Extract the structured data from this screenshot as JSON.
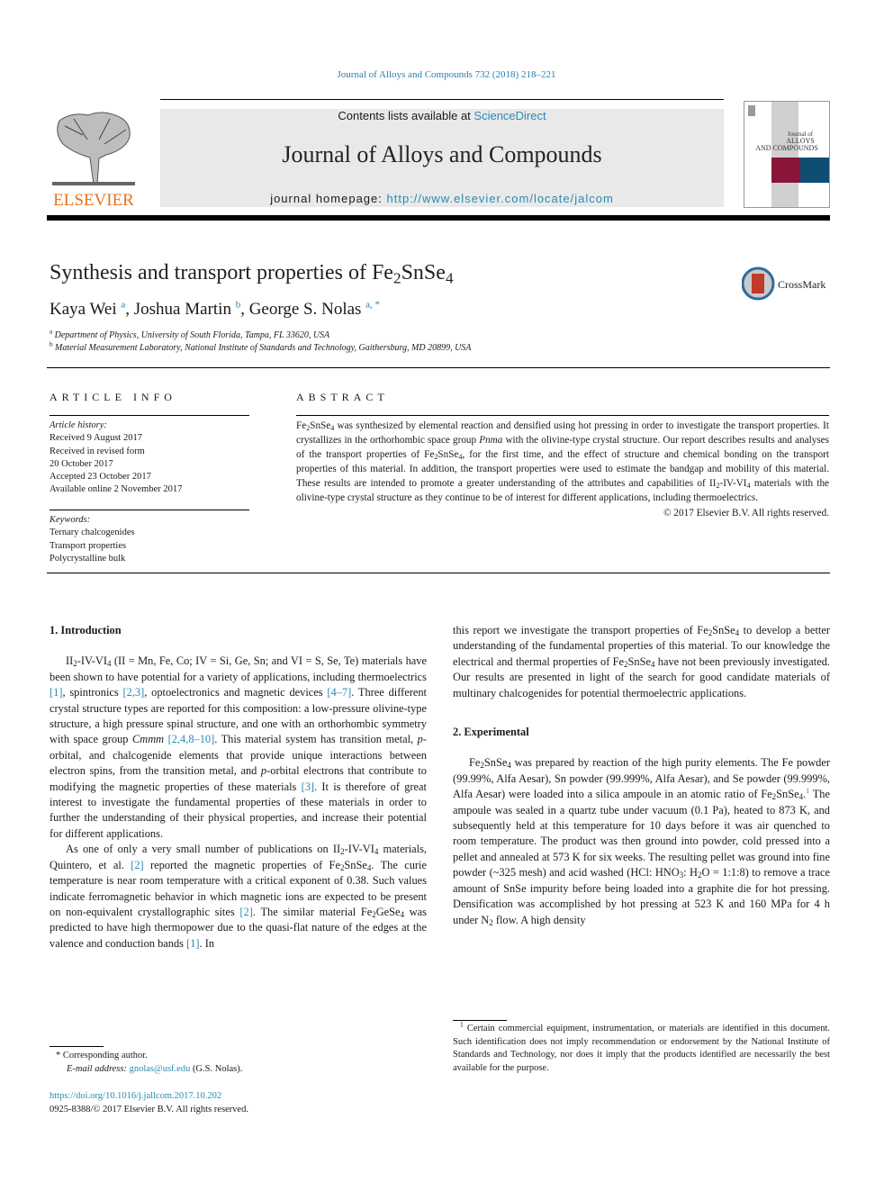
{
  "header": {
    "journal_reference": "Journal of Alloys and Compounds 732 (2018) 218–221",
    "contents_prefix": "Contents lists available at ",
    "contents_link": "ScienceDirect",
    "journal_title": "Journal of Alloys and Compounds",
    "homepage_prefix": "journal homepage: ",
    "homepage_link": "http://www.elsevier.com/locate/jalcom",
    "publisher_logo_text": "ELSEVIER",
    "cover": {
      "line1": "Journal of",
      "line2": "ALLOYS",
      "line3": "AND COMPOUNDS"
    },
    "colors": {
      "link": "#2a8ab0",
      "elsevier_orange": "#e9711c",
      "cover_red": "#8b1538",
      "cover_blue": "#0e4e72"
    }
  },
  "article": {
    "title_parts": [
      "Synthesis and transport properties of Fe",
      "2",
      "SnSe",
      "4"
    ],
    "crossmark_label": "CrossMark",
    "authors": [
      {
        "name": "Kaya Wei",
        "aff": "a"
      },
      {
        "name": "Joshua Martin",
        "aff": "b"
      },
      {
        "name": "George S. Nolas",
        "aff": "a, *"
      }
    ],
    "affiliations": [
      {
        "key": "a",
        "text": "Department of Physics, University of South Florida, Tampa, FL 33620, USA"
      },
      {
        "key": "b",
        "text": "Material Measurement Laboratory, National Institute of Standards and Technology, Gaithersburg, MD 20899, USA"
      }
    ]
  },
  "article_info": {
    "heading": "ARTICLE INFO",
    "history_label": "Article history:",
    "history": [
      "Received 9 August 2017",
      "Received in revised form",
      "20 October 2017",
      "Accepted 23 October 2017",
      "Available online 2 November 2017"
    ],
    "keywords_label": "Keywords:",
    "keywords": [
      "Ternary chalcogenides",
      "Transport properties",
      "Polycrystalline bulk"
    ]
  },
  "abstract": {
    "heading": "ABSTRACT",
    "copyright": "© 2017 Elsevier B.V. All rights reserved."
  },
  "sections": {
    "intro_heading": "1.  Introduction",
    "experimental_heading": "2.  Experimental"
  },
  "footnotes": {
    "corresponding": "* Corresponding author.",
    "email_label": "E-mail address: ",
    "email": "gnolas@usf.edu",
    "email_suffix": " (G.S. Nolas).",
    "doi": "https://doi.org/10.1016/j.jallcom.2017.10.202",
    "issn": "0925-8388/© 2017 Elsevier B.V. All rights reserved.",
    "fn1_mark": "1",
    "fn1_text": "Certain commercial equipment, instrumentation, or materials are identified in this document. Such identification does not imply recommendation or endorsement by the National Institute of Standards and Technology, nor does it imply that the products identified are necessarily the best available for the purpose."
  }
}
